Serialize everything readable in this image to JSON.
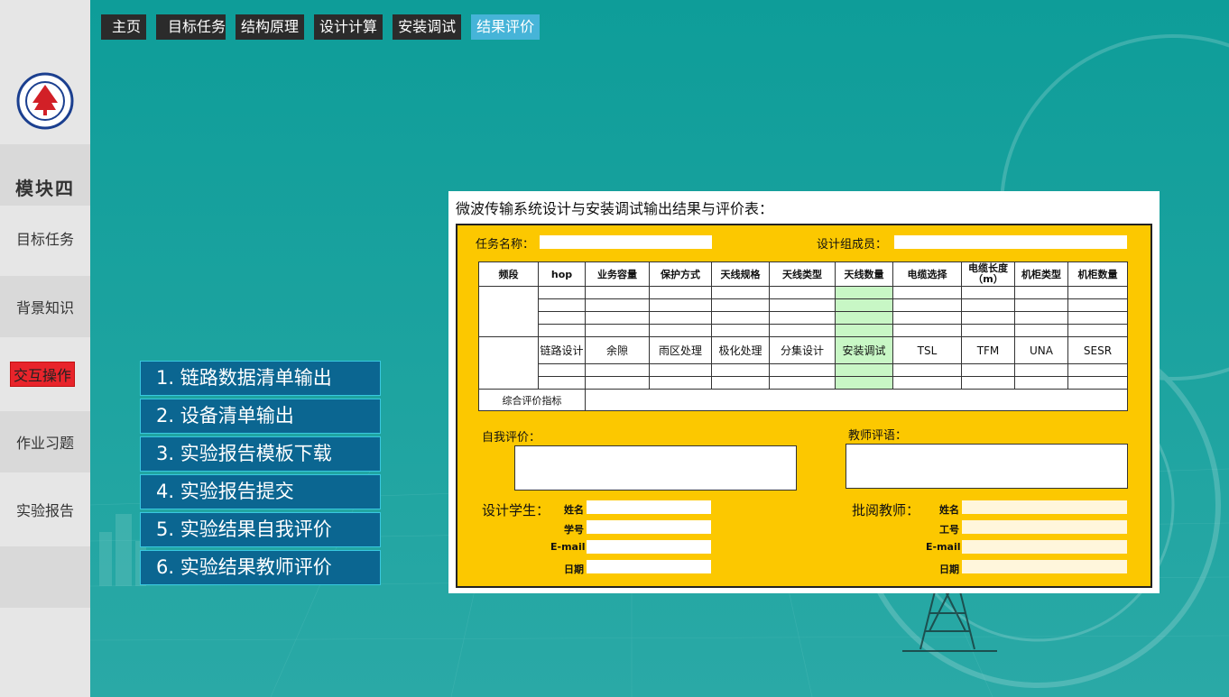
{
  "nav": {
    "tabs": [
      {
        "label": "主页",
        "active": false
      },
      {
        "label": "目标任务",
        "active": false
      },
      {
        "label": "结构原理",
        "active": false
      },
      {
        "label": "设计计算",
        "active": false
      },
      {
        "label": "安装调试",
        "active": false
      },
      {
        "label": "结果评价",
        "active": true
      }
    ]
  },
  "sidebar": {
    "module": "模块四",
    "items": [
      {
        "label": "目标任务"
      },
      {
        "label": "背景知识"
      },
      {
        "label": "交互操作",
        "active": true
      },
      {
        "label": "作业习题"
      },
      {
        "label": "实验报告"
      }
    ]
  },
  "menu": {
    "items": [
      "1. 链路数据清单输出",
      "2. 设备清单输出",
      "3. 实验报告模板下载",
      "4. 实验报告提交",
      "5. 实验结果自我评价",
      "6. 实验结果教师评价"
    ]
  },
  "panel": {
    "title": "微波传输系统设计与安装调试输出结果与评价表：",
    "task_name_label": "任务名称：",
    "team_label": "设计组成员：",
    "table": {
      "headers": [
        "频段",
        "hop",
        "业务容量",
        "保护方式",
        "天线规格",
        "天线类型",
        "天线数量",
        "电缆选择",
        "电缆长度（m）",
        "机柜类型",
        "机柜数量"
      ],
      "row2": [
        "链路设计",
        "余隙",
        "雨区处理",
        "极化处理",
        "分集设计",
        "安装调试",
        "TSL",
        "TFM",
        "UNA",
        "SESR"
      ],
      "summary_label": "综合评价指标"
    },
    "self_eval_label": "自我评价：",
    "teacher_comment_label": "教师评语：",
    "student_label": "设计学生：",
    "teacher_label": "批阅教师：",
    "student_fields": [
      "姓名",
      "学号",
      "E-mail",
      "日期"
    ],
    "teacher_fields": [
      "姓名",
      "工号",
      "E-mail",
      "日期"
    ]
  },
  "colors": {
    "background": "#13a19c",
    "menu_button": "#0b6691",
    "form": "#fcc800",
    "active_tab": "#46b4d8",
    "active_side": "#e8242b"
  }
}
